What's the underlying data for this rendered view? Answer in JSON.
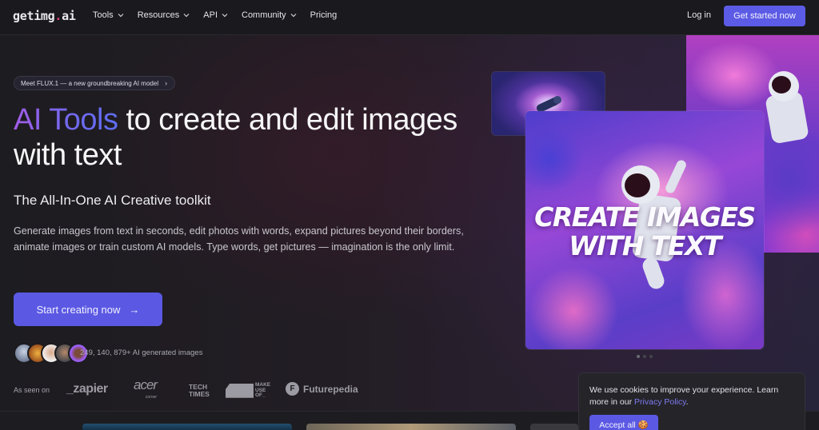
{
  "nav": {
    "logo_prefix": "getimg",
    "logo_dot": ".",
    "logo_suffix": "ai",
    "links": [
      {
        "label": "Tools",
        "has_dropdown": true
      },
      {
        "label": "Resources",
        "has_dropdown": true
      },
      {
        "label": "API",
        "has_dropdown": true
      },
      {
        "label": "Community",
        "has_dropdown": true
      },
      {
        "label": "Pricing",
        "has_dropdown": false
      }
    ],
    "login_label": "Log in",
    "cta_label": "Get started now"
  },
  "hero": {
    "announcement": "Meet FLUX.1 — a new groundbreaking AI model",
    "announcement_chevron": "›",
    "headline_highlight": "AI Tools",
    "headline_rest": " to create and edit images with text",
    "subheadline": "The All-In-One AI Creative toolkit",
    "description": "Generate images from text in seconds, edit photos with words, expand pictures beyond their borders, animate images or train custom AI models. Type words, get pictures — imagination is the only limit.",
    "cta_label": "Start creating now",
    "cta_arrow": "→",
    "stat_text": "249, 140, 879+ AI generated images",
    "avatar_count": 5,
    "as_seen_on_label": "As seen on",
    "brands": {
      "zapier": "_zapier",
      "acer": "acer",
      "acer_sub": "corner",
      "techtimes_1": "TECH",
      "techtimes_2": "TIMES",
      "muo_1": "MAKE",
      "muo_2": "USE",
      "muo_3": "OF_",
      "futurepedia_icon": "F",
      "futurepedia": "Futurepedia"
    }
  },
  "showcase": {
    "main_image_text_line1": "CREATE IMAGES",
    "main_image_text_line2": "WITH TEXT",
    "carousel_total": 3,
    "carousel_active": 1
  },
  "cookie": {
    "text_before": "We use cookies to improve your experience. Learn more in our ",
    "link_label": "Privacy Policy",
    "text_after": ".",
    "accept_label": "Accept all 🍪"
  },
  "colors": {
    "accent": "#5c5be5",
    "gradient_start": "#a25ce6",
    "gradient_end": "#5e6df0",
    "logo_dot": "#e0457b",
    "background": "#1c1b1f"
  }
}
